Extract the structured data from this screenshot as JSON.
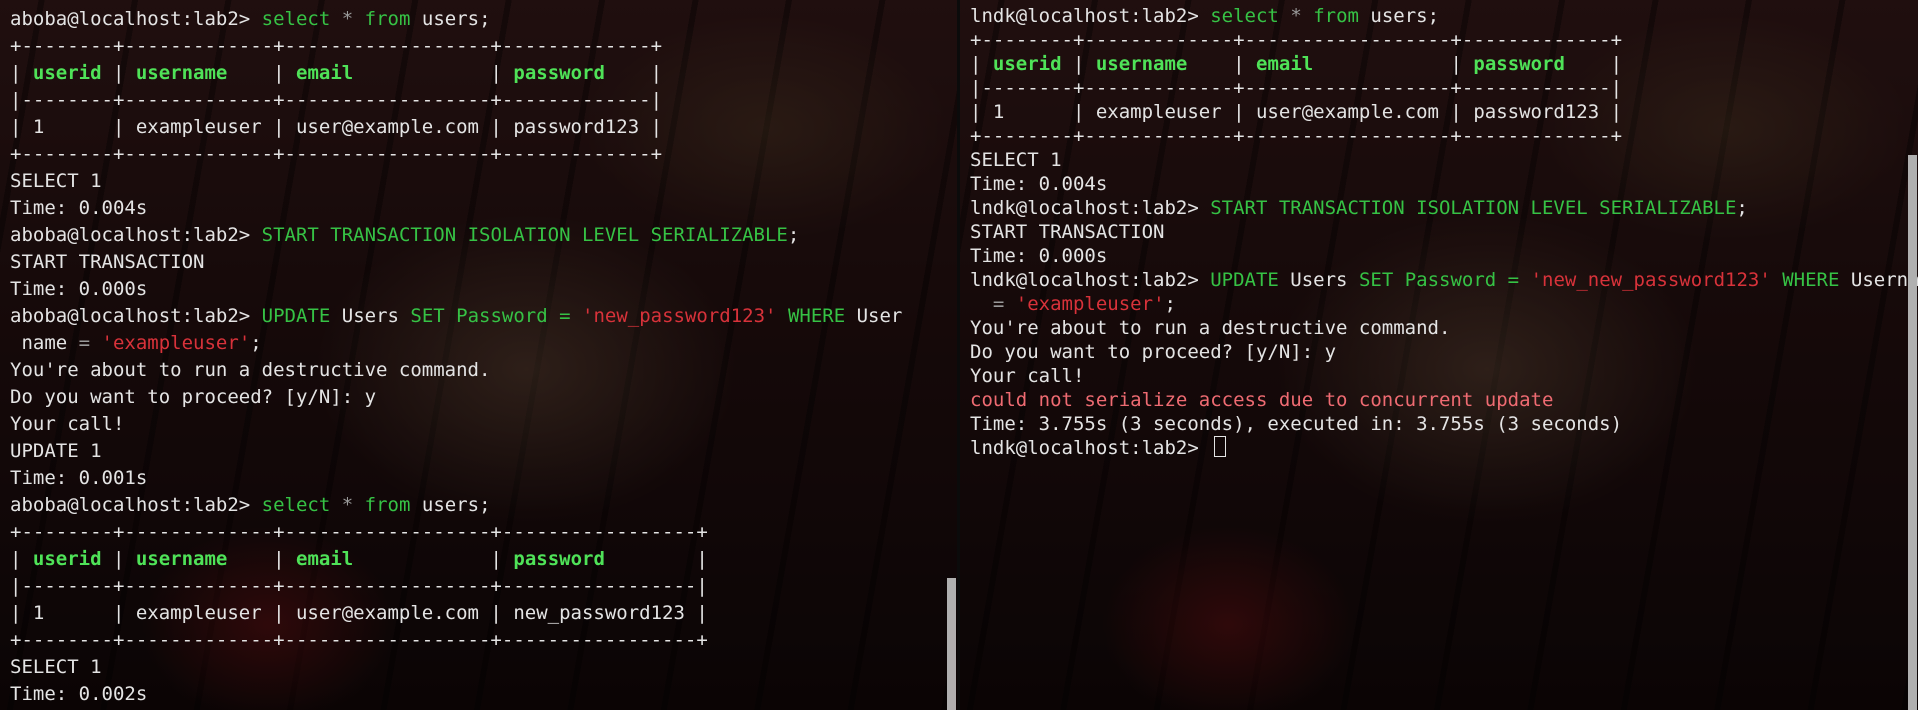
{
  "left": {
    "l01_prompt": "aboba@localhost:lab2> ",
    "l01_select": "select",
    "l01_star": "*",
    "l01_from": "from",
    "l01_rest": " users;",
    "t1_border": "+--------+-------------+------------------+-------------+",
    "t1_col1": "userid",
    "t1_col2": "username",
    "t1_col3": "email",
    "t1_col4": "password",
    "t1_sep": "|--------+-------------+------------------+-------------|",
    "t1_row": "| 1      | exampleuser | user@example.com | password123 |",
    "l07": "SELECT 1",
    "l08": "Time: 0.004s",
    "l09_prompt": "aboba@localhost:lab2> ",
    "l09_cmd": "START TRANSACTION ISOLATION LEVEL SERIALIZABLE",
    "l09_end": ";",
    "l10": "START TRANSACTION",
    "l11": "Time: 0.000s",
    "l12_prompt": "aboba@localhost:lab2> ",
    "l12_update": "UPDATE",
    "l12_users": " Users ",
    "l12_set": "SET",
    "l12_password": " Password ",
    "l12_eq": "=",
    "l12_str": "'new_password123'",
    "l12_where": "WHERE",
    "l12_user": " User",
    "l13_name": " name ",
    "l13_eq": "=",
    "l13_str": "'exampleuser'",
    "l13_end": ";",
    "l14": "You're about to run a destructive command.",
    "l15": "Do you want to proceed? [y/N]: y",
    "l16": "Your call!",
    "l17": "UPDATE 1",
    "l18": "Time: 0.001s",
    "l19_prompt": "aboba@localhost:lab2> ",
    "l19_select": "select",
    "l19_star": "*",
    "l19_from": "from",
    "l19_rest": " users;",
    "t2_border": "+--------+-------------+------------------+-----------------+",
    "t2_col1": "userid",
    "t2_col2": "username",
    "t2_col3": "email",
    "t2_col4": "password",
    "t2_sep": "|--------+-------------+------------------+-----------------|",
    "t2_row": "| 1      | exampleuser | user@example.com | new_password123 |",
    "l25": "SELECT 1",
    "l26": "Time: 0.002s"
  },
  "right": {
    "r01_prompt": "lndk@localhost:lab2> ",
    "r01_select": "select",
    "r01_star": "*",
    "r01_from": "from",
    "r01_rest": " users;",
    "t_border": "+--------+-------------+------------------+-------------+",
    "t_col1": "userid",
    "t_col2": "username",
    "t_col3": "email",
    "t_col4": "password",
    "t_sep": "|--------+-------------+------------------+-------------|",
    "t_row": "| 1      | exampleuser | user@example.com | password123 |",
    "r07": "SELECT 1",
    "r08": "Time: 0.004s",
    "r09_prompt": "lndk@localhost:lab2> ",
    "r09_cmd": "START TRANSACTION ISOLATION LEVEL SERIALIZABLE",
    "r09_end": ";",
    "r10": "START TRANSACTION",
    "r11": "Time: 0.000s",
    "r12_prompt": "lndk@localhost:lab2> ",
    "r12_update": "UPDATE",
    "r12_users": " Users ",
    "r12_set": "SET",
    "r12_password": " Password ",
    "r12_eq": "=",
    "r12_str": "'new_new_password123'",
    "r12_where": "WHERE",
    "r12_user": " Username",
    "r13_eq": "=",
    "r13_str": "'exampleuser'",
    "r13_end": ";",
    "r14": "You're about to run a destructive command.",
    "r15": "Do you want to proceed? [y/N]: y",
    "r16": "Your call!",
    "r17": "could not serialize access due to concurrent update",
    "r18": "Time: 3.755s (3 seconds), executed in: 3.755s (3 seconds)",
    "r19_prompt": "lndk@localhost:lab2> "
  },
  "colors": {
    "keyword": "#36c245",
    "string": "#d8323a",
    "header": "#4fe258",
    "error": "#ef6b72",
    "text": "#e4e4e4"
  }
}
